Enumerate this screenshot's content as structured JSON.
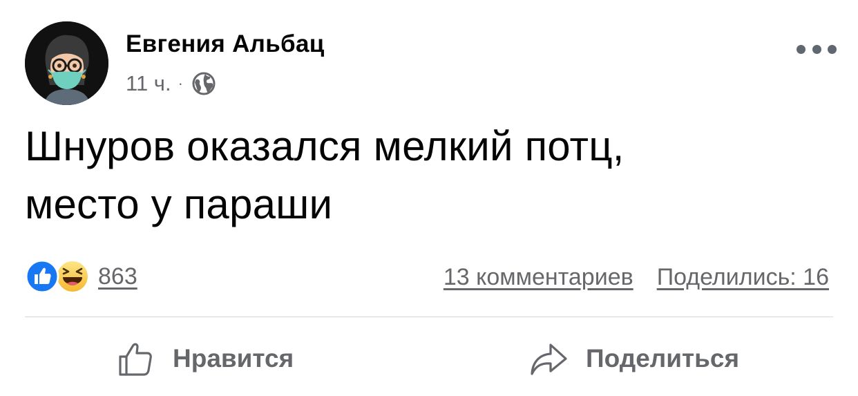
{
  "post": {
    "author": "Евгения Альбац",
    "time": "11 ч.",
    "separator": "·",
    "privacy_icon": "globe-icon",
    "text_lines": [
      "Шнуров оказался мелкий потц,",
      "место у параши"
    ]
  },
  "stats": {
    "reaction_icons": [
      "like-icon",
      "haha-icon"
    ],
    "reactions_count": "863",
    "comments": "13 комментариев",
    "shares": "Поделились: 16"
  },
  "actions": {
    "like_label": "Нравится",
    "share_label": "Поделиться"
  },
  "colors": {
    "text_primary": "#050505",
    "text_secondary": "#65676b",
    "like_blue": "#1877f2",
    "haha_yellow": "#f7c93d",
    "divider": "#d6d8dc"
  }
}
